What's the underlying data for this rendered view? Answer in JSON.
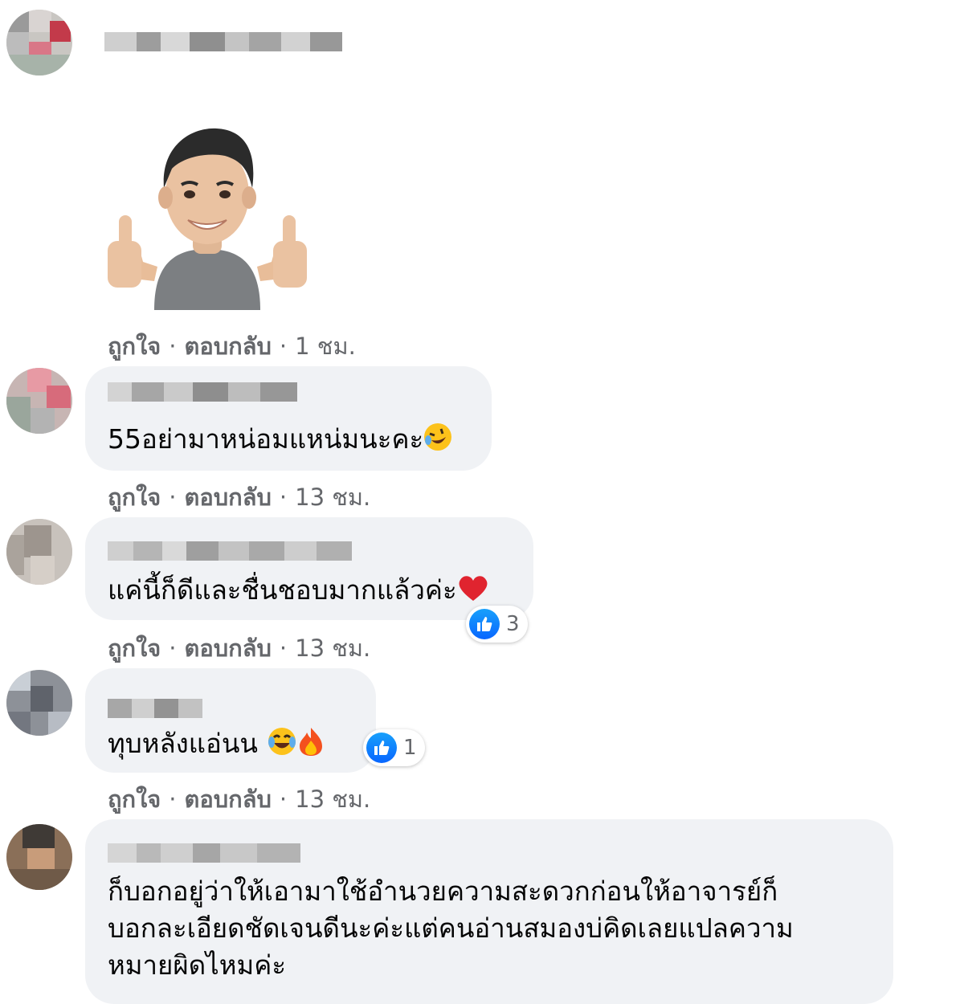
{
  "comments": [
    {
      "text": "",
      "sticker": "thumbs-up-avatar-sticker",
      "meta": {
        "like": "ถูกใจ",
        "reply": "ตอบกลับ",
        "time": "1 ชม."
      }
    },
    {
      "text": "55อย่ามาหน่อมแหน่มนะคะ",
      "emoji": "rofl-emoji",
      "meta": {
        "like": "ถูกใจ",
        "reply": "ตอบกลับ",
        "time": "13 ชม."
      }
    },
    {
      "text": "แค่นี้ก็ดีและชื่นชอบมากแล้วค่ะ",
      "emoji": "red-heart-emoji",
      "reaction": {
        "icon": "like-icon",
        "count": "3"
      },
      "meta": {
        "like": "ถูกใจ",
        "reply": "ตอบกลับ",
        "time": "13 ชม."
      }
    },
    {
      "text": "ทุบหลังแอ่นน",
      "emoji": "joy-emoji fire-emoji",
      "reaction": {
        "icon": "like-icon",
        "count": "1"
      },
      "meta": {
        "like": "ถูกใจ",
        "reply": "ตอบกลับ",
        "time": "13 ชม."
      }
    },
    {
      "lines": [
        "ก็บอกอยู่ว่าให้เอามาใช้อำนวยความสะดวกก่อนให้อาจารย์ก็",
        "บอกละเอียดชัดเจนดีนะค่ะแต่คนอ่านสมองบ่คิดเลยแปลความ",
        "หมายผิดไหมค่ะ"
      ]
    }
  ],
  "colors": {
    "bubble": "#f0f2f5",
    "meta_text": "#65676b",
    "like_blue": "#0866ff",
    "heart": "#e0242f"
  }
}
